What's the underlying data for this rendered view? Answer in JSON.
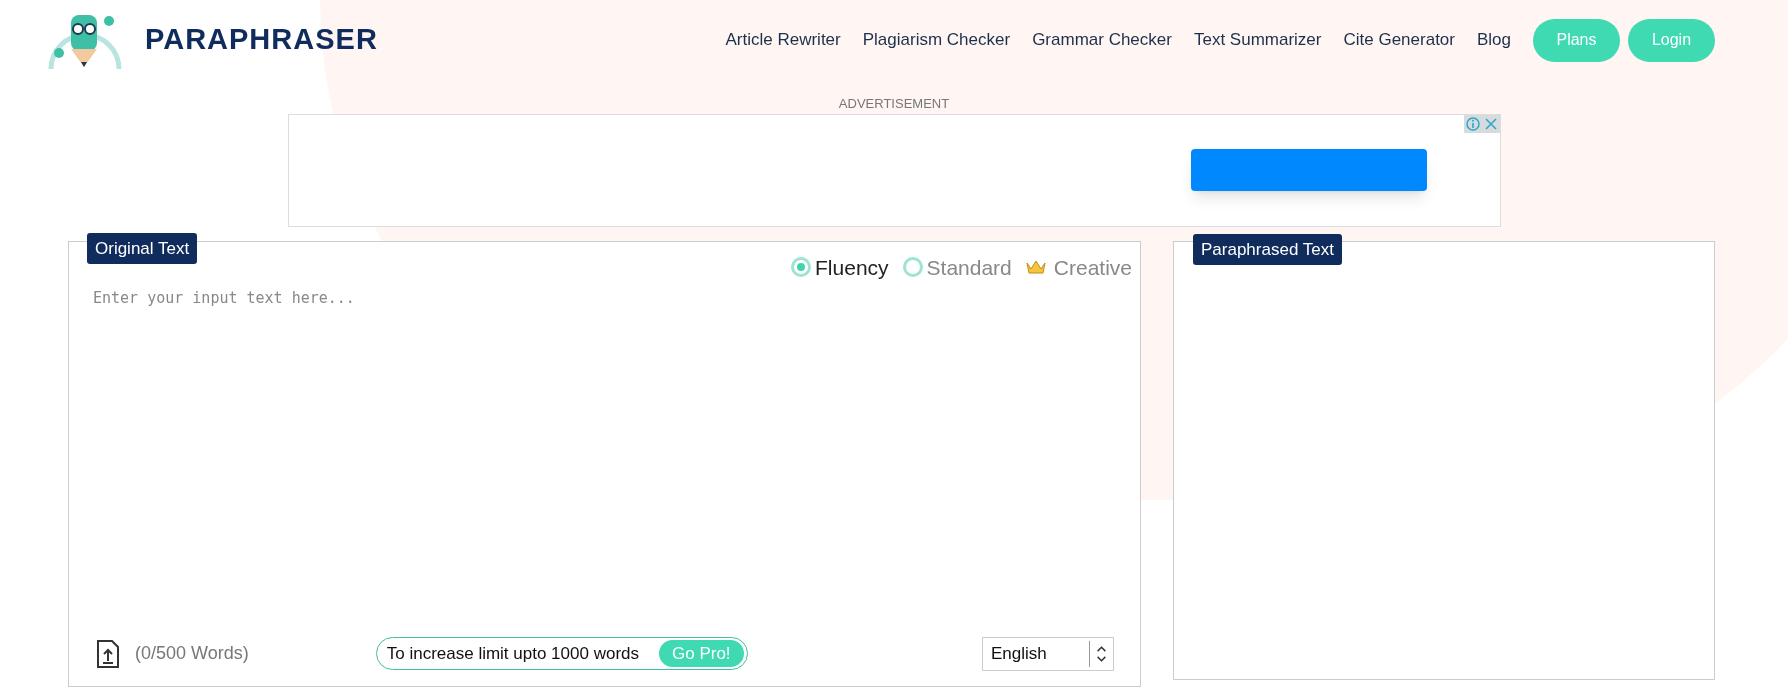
{
  "brand": {
    "name": "PARAPHRASER"
  },
  "nav": {
    "links": [
      "Article Rewriter",
      "Plagiarism Checker",
      "Grammar Checker",
      "Text Summarizer",
      "Cite Generator",
      "Blog"
    ],
    "buttons": [
      "Plans",
      "Login"
    ]
  },
  "advertisement": {
    "label": "ADVERTISEMENT"
  },
  "input_panel": {
    "title": "Original Text",
    "modes": [
      {
        "label": "Fluency",
        "kind": "radio",
        "selected": true
      },
      {
        "label": "Standard",
        "kind": "radio",
        "selected": false
      },
      {
        "label": "Creative",
        "kind": "premium",
        "selected": false
      }
    ],
    "placeholder": "Enter your input text here...",
    "word_count": "(0/500 Words)",
    "promo": {
      "text": "To increase limit upto 1000 words",
      "button": "Go Pro!"
    },
    "language": "English"
  },
  "output_panel": {
    "title": "Paraphrased Text"
  }
}
